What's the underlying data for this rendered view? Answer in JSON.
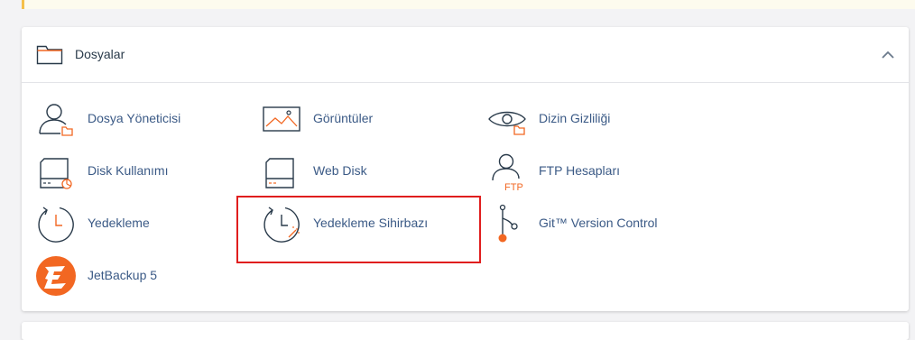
{
  "panel": {
    "title": "Dosyalar",
    "icon": "folder-icon",
    "collapse_icon": "chevron-up-icon"
  },
  "items": [
    {
      "label": "Dosya Yöneticisi",
      "icon": "file-manager-icon"
    },
    {
      "label": "Görüntüler",
      "icon": "images-icon"
    },
    {
      "label": "Dizin Gizliliği",
      "icon": "directory-privacy-icon"
    },
    {
      "label": "Disk Kullanımı",
      "icon": "disk-usage-icon"
    },
    {
      "label": "Web Disk",
      "icon": "web-disk-icon"
    },
    {
      "label": "FTP Hesapları",
      "icon": "ftp-accounts-icon",
      "badge": "FTP"
    },
    {
      "label": "Yedekleme",
      "icon": "backup-icon"
    },
    {
      "label": "Yedekleme Sihirbazı",
      "icon": "backup-wizard-icon"
    },
    {
      "label": "Git™ Version Control",
      "icon": "git-icon"
    },
    {
      "label": "JetBackup 5",
      "icon": "jetbackup-icon"
    }
  ],
  "colors": {
    "accent": "#f26722",
    "link": "#3b5a86",
    "icon_stroke": "#293a4a",
    "highlight": "#e01e1e"
  }
}
